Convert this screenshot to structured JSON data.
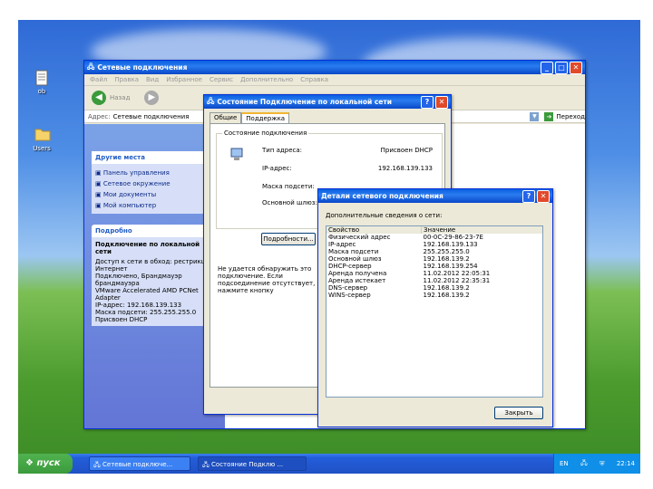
{
  "desktop": {
    "icons": [
      {
        "label": "ob"
      },
      {
        "label": "Users"
      }
    ]
  },
  "net_window": {
    "title": "Сетевые подключения",
    "menu": [
      "Файл",
      "Правка",
      "Вид",
      "Избранное",
      "Сервис",
      "Дополнительно",
      "Справка"
    ],
    "back_label": "Назад",
    "address_label": "Адрес:",
    "address_value": "Сетевые подключения",
    "go_label": "Переход",
    "other_places_title": "Другие места",
    "other_places": [
      "Панель управления",
      "Сетевое окружение",
      "Мои документы",
      "Мой компьютер"
    ],
    "details_title": "Подробно",
    "details_name": "Подключение по локальной сети",
    "details_lines": [
      "Доступ к сети в обход: рестрикций",
      "Интернет",
      "Подключено, Брандмауэр",
      "брандмауэра",
      "VMware Accelerated AMD PCNet",
      "Adapter",
      "IP-адрес: 192.168.139.133",
      "Маска подсети: 255.255.255.0",
      "Присвоен DHCP"
    ]
  },
  "status_dialog": {
    "title": "Состояние Подключение по локальной сети",
    "tabs": [
      "Общие",
      "Поддержка"
    ],
    "group_title": "Состояние подключения",
    "fields": [
      {
        "label": "Тип адреса:",
        "value": "Присвоен DHCP"
      },
      {
        "label": "IP-адрес:",
        "value": "192.168.139.133"
      },
      {
        "label": "Маска подсети:",
        "value": ""
      },
      {
        "label": "Основной шлюз:",
        "value": ""
      }
    ],
    "details_button": "Подробности...",
    "note": "Не удается обнаружить это подключение. Если подсоединение отсутствует, нажмите кнопку"
  },
  "details_dialog": {
    "title": "Детали сетевого подключения",
    "caption": "Дополнительные сведения о сети:",
    "headers": [
      "Свойство",
      "Значение"
    ],
    "rows": [
      [
        "Физический адрес",
        "00-0C-29-86-23-7E"
      ],
      [
        "IP-адрес",
        "192.168.139.133"
      ],
      [
        "Маска подсети",
        "255.255.255.0"
      ],
      [
        "Основной шлюз",
        "192.168.139.2"
      ],
      [
        "DHCP-сервер",
        "192.168.139.254"
      ],
      [
        "Аренда получена",
        "11.02.2012 22:05:31"
      ],
      [
        "Аренда истекает",
        "11.02.2012 22:35:31"
      ],
      [
        "DNS-сервер",
        "192.168.139.2"
      ],
      [
        "WINS-сервер",
        "192.168.139.2"
      ]
    ],
    "close_button": "Закрыть"
  },
  "taskbar": {
    "start_label": "пуск",
    "tasks": [
      "Сетевые подключе...",
      "Состояние Подклю ..."
    ],
    "lang": "EN",
    "clock": "22:14"
  },
  "colors": {
    "title_blue": "#0a5fe0",
    "taskbar_blue": "#245edb",
    "start_green": "#3c9a3c",
    "close_red": "#e04a2a"
  }
}
